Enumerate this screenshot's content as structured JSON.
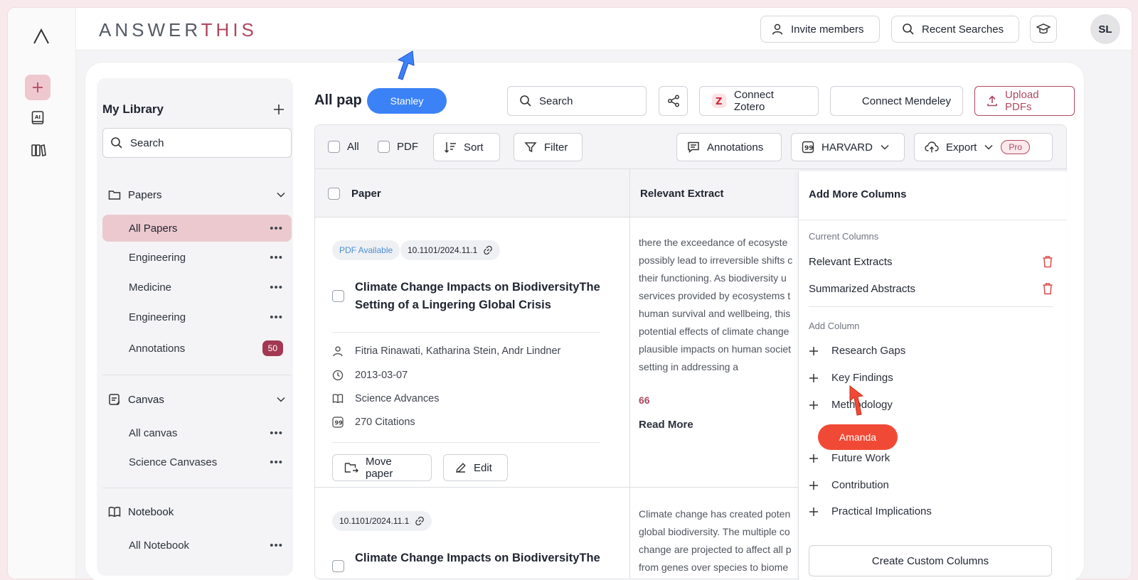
{
  "app": {
    "brand_main": "ANSWERTHIS",
    "avatar_initials": "SL"
  },
  "topbar": {
    "invite_label": "Invite members",
    "recent_label": "Recent Searches"
  },
  "sidebar": {
    "title": "My Library",
    "search_placeholder": "Search",
    "papers_group": "Papers",
    "papers_items": [
      {
        "label": "All Papers"
      },
      {
        "label": "Engineering"
      },
      {
        "label": "Medicine"
      },
      {
        "label": "Engineering"
      },
      {
        "label": "Annotations",
        "badge": "50"
      }
    ],
    "canvas_group": "Canvas",
    "canvas_items": [
      {
        "label": "All canvas"
      },
      {
        "label": "Science Canvases"
      }
    ],
    "notebook_group": "Notebook",
    "notebook_items": [
      {
        "label": "All Notebook"
      }
    ]
  },
  "content": {
    "title": "All pap",
    "search_placeholder": "Search",
    "connect_zotero": "Connect Zotero",
    "connect_mendeley": "Connect Mendeley",
    "upload_pdfs": "Upload PDFs"
  },
  "toolbar": {
    "all_label": "All",
    "pdf_label": "PDF",
    "sort_label": "Sort",
    "filter_label": "Filter",
    "annotations_label": "Annotations",
    "citation_style": "HARVARD",
    "export_label": "Export",
    "pro_label": "Pro"
  },
  "table": {
    "col_paper": "Paper",
    "col_extract": "Relevant Extract",
    "rows": [
      {
        "pdf_tag": "PDF Available",
        "doi": "10.1101/2024.11.1",
        "title_line1": "Climate Change Impacts on BiodiversityThe",
        "title_line2": "Setting of a Lingering Global Crisis",
        "authors": "Fitria Rinawati, Katharina Stein, Andr Lindner",
        "date": "2013-03-07",
        "journal": "Science Advances",
        "citations": "270 Citations",
        "move_label": "Move paper",
        "edit_label": "Edit",
        "extract_lines": [
          "there the exceedance of ecosyste",
          "possibly lead to irreversible shifts c",
          "their functioning. As biodiversity u",
          "services provided by ecosystems t",
          "human survival and wellbeing, this",
          "potential effects of climate change",
          "plausible impacts on human societ",
          "setting in addressing a"
        ],
        "quote_number": "66",
        "read_more": "Read More"
      },
      {
        "doi": "10.1101/2024.11.1",
        "title_line1": "Climate Change Impacts on BiodiversityThe",
        "extract_lines": [
          "Climate change has created poten",
          "global biodiversity. The multiple co",
          "change are projected to affect all p",
          "from genes over species to biome"
        ]
      }
    ]
  },
  "columns_panel": {
    "title": "Add More Columns",
    "current_heading": "Current Columns",
    "current": [
      "Relevant Extracts",
      "Summarized Abstracts"
    ],
    "add_heading": "Add Column",
    "add_options": [
      "Research Gaps",
      "Key Findings",
      "Methodology",
      "Future Work",
      "Contribution",
      "Practical Implications"
    ],
    "create_custom": "Create Custom Columns"
  },
  "cursors": {
    "blue_name": "Stanley",
    "red_name": "Amanda"
  },
  "colors": {
    "brand_accent": "#b0475e",
    "active_item_bg": "#ecc9cf",
    "badge_bg": "#a33852",
    "cursor_blue": "#3b82f6",
    "cursor_red": "#f04a36"
  }
}
